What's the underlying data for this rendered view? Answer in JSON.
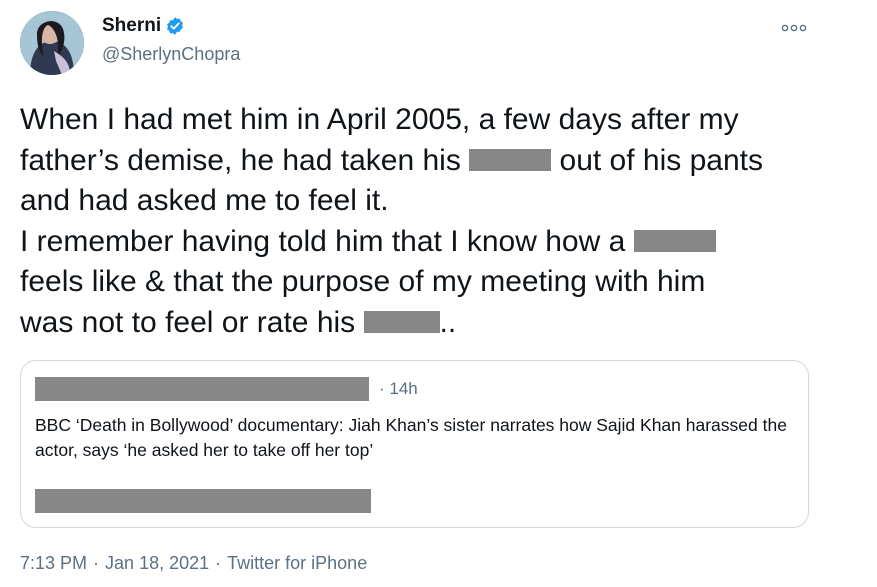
{
  "author": {
    "display_name": "Sherni",
    "handle": "@SherlynChopra",
    "verified": true,
    "verified_icon": "verified-badge-icon",
    "more_icon": "more-options-icon"
  },
  "tweet": {
    "lines": [
      {
        "before": "When I had met him in April 2005, a few days after my",
        "after": ""
      },
      {
        "before": "father’s demise, he had taken his ",
        "after": " out of his pants"
      },
      {
        "before": "and had asked me to feel it.",
        "after": ""
      },
      {
        "before": "I remember having told him that I know how a ",
        "after": ""
      },
      {
        "before": "feels like & that the purpose of my meeting with him",
        "after": ""
      },
      {
        "before": "was not to feel or rate his ",
        "after": ".."
      }
    ]
  },
  "quoted_tweet": {
    "time": "· 14h",
    "text": "BBC ‘Death in Bollywood’ documentary: Jiah Khan’s sister narrates how Sajid Khan harassed the actor, says ‘he asked her to take off her top’"
  },
  "meta": {
    "time": "7:13 PM",
    "sep1": "·",
    "date": "Jan 18, 2021",
    "sep2": "·",
    "source": "Twitter for iPhone"
  },
  "colors": {
    "text": "#0f1419",
    "secondary": "#5b7083",
    "verified": "#1d9bf0",
    "redaction": "#878787",
    "border": "#cfd9de"
  }
}
